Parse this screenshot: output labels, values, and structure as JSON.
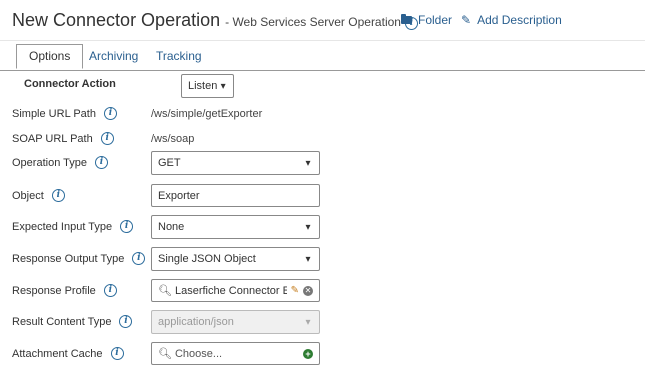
{
  "header": {
    "title": "New Connector Operation",
    "subtitle": "- Web Services Server Operation",
    "folder_label": "Folder",
    "add_description_label": "Add Description"
  },
  "tabs": [
    {
      "label": "Options",
      "active": true
    },
    {
      "label": "Archiving",
      "active": false
    },
    {
      "label": "Tracking",
      "active": false
    }
  ],
  "form": {
    "connector_action": {
      "label": "Connector Action",
      "value": "Listen"
    },
    "simple_url_path": {
      "label": "Simple URL Path",
      "value": "/ws/simple/getExporter"
    },
    "soap_url_path": {
      "label": "SOAP URL Path",
      "value": "/ws/soap"
    },
    "operation_type": {
      "label": "Operation Type",
      "value": "GET"
    },
    "object": {
      "label": "Object",
      "value": "Exporter"
    },
    "expected_input_type": {
      "label": "Expected Input Type",
      "value": "None"
    },
    "response_output_type": {
      "label": "Response Output Type",
      "value": "Single JSON Object"
    },
    "response_profile": {
      "label": "Response Profile",
      "value": "Laserfiche Connector Er"
    },
    "result_content_type": {
      "label": "Result Content Type",
      "value": "application/json"
    },
    "attachment_cache": {
      "label": "Attachment Cache",
      "placeholder": "Choose..."
    }
  },
  "icons": {
    "info": "info-icon",
    "folder": "folder-icon",
    "edit": "pencil-icon",
    "search": "search-icon",
    "clear": "clear-icon",
    "add": "add-icon",
    "dropdown": "chevron-down-icon"
  },
  "colors": {
    "link": "#2a5f8f",
    "info_icon": "#2c6c9c",
    "add_green": "#2e7d32"
  }
}
